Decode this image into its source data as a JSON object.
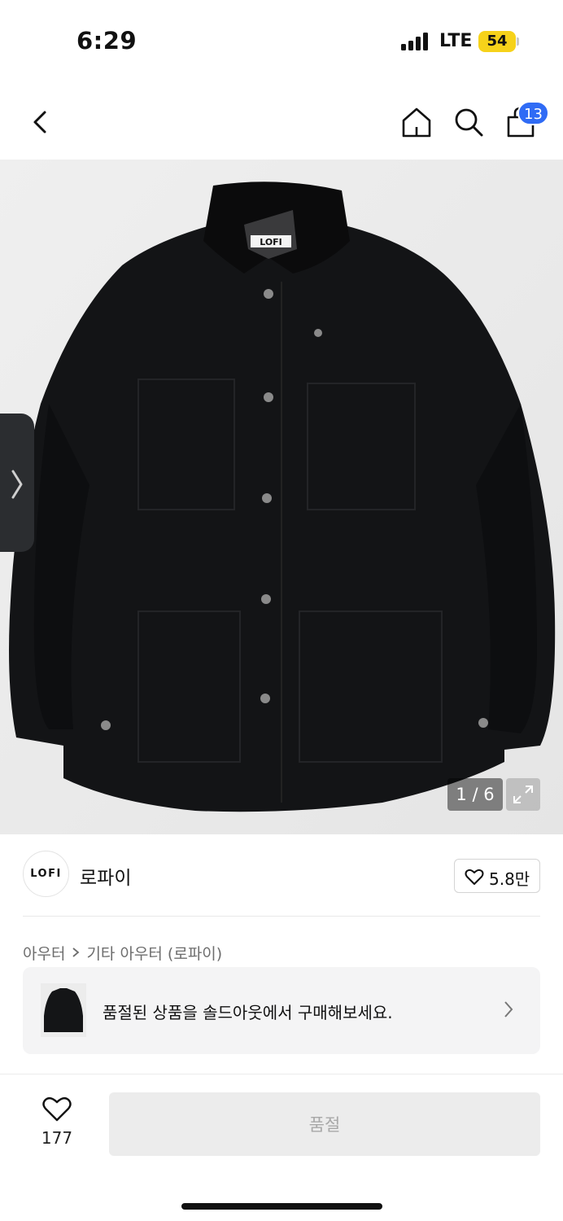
{
  "status_bar": {
    "time": "6:29",
    "network": "LTE",
    "battery": "54"
  },
  "nav": {
    "cart_count": "13"
  },
  "hero": {
    "image_counter": "1 / 6",
    "brand_label": "LOFI"
  },
  "brand": {
    "logo_text": "LOFI",
    "name": "로파이",
    "likes": "5.8만"
  },
  "breadcrumb": {
    "level1": "아우터",
    "level2": "기타 아우터 (로파이)"
  },
  "soldout_card": {
    "text": "품절된 상품을 솔드아웃에서 구매해보세요."
  },
  "bottom_bar": {
    "wish_count": "177",
    "buy_label": "품절"
  },
  "colors": {
    "accent": "#2f6bf5",
    "battery": "#f6d21a",
    "jacket": "#131416"
  }
}
